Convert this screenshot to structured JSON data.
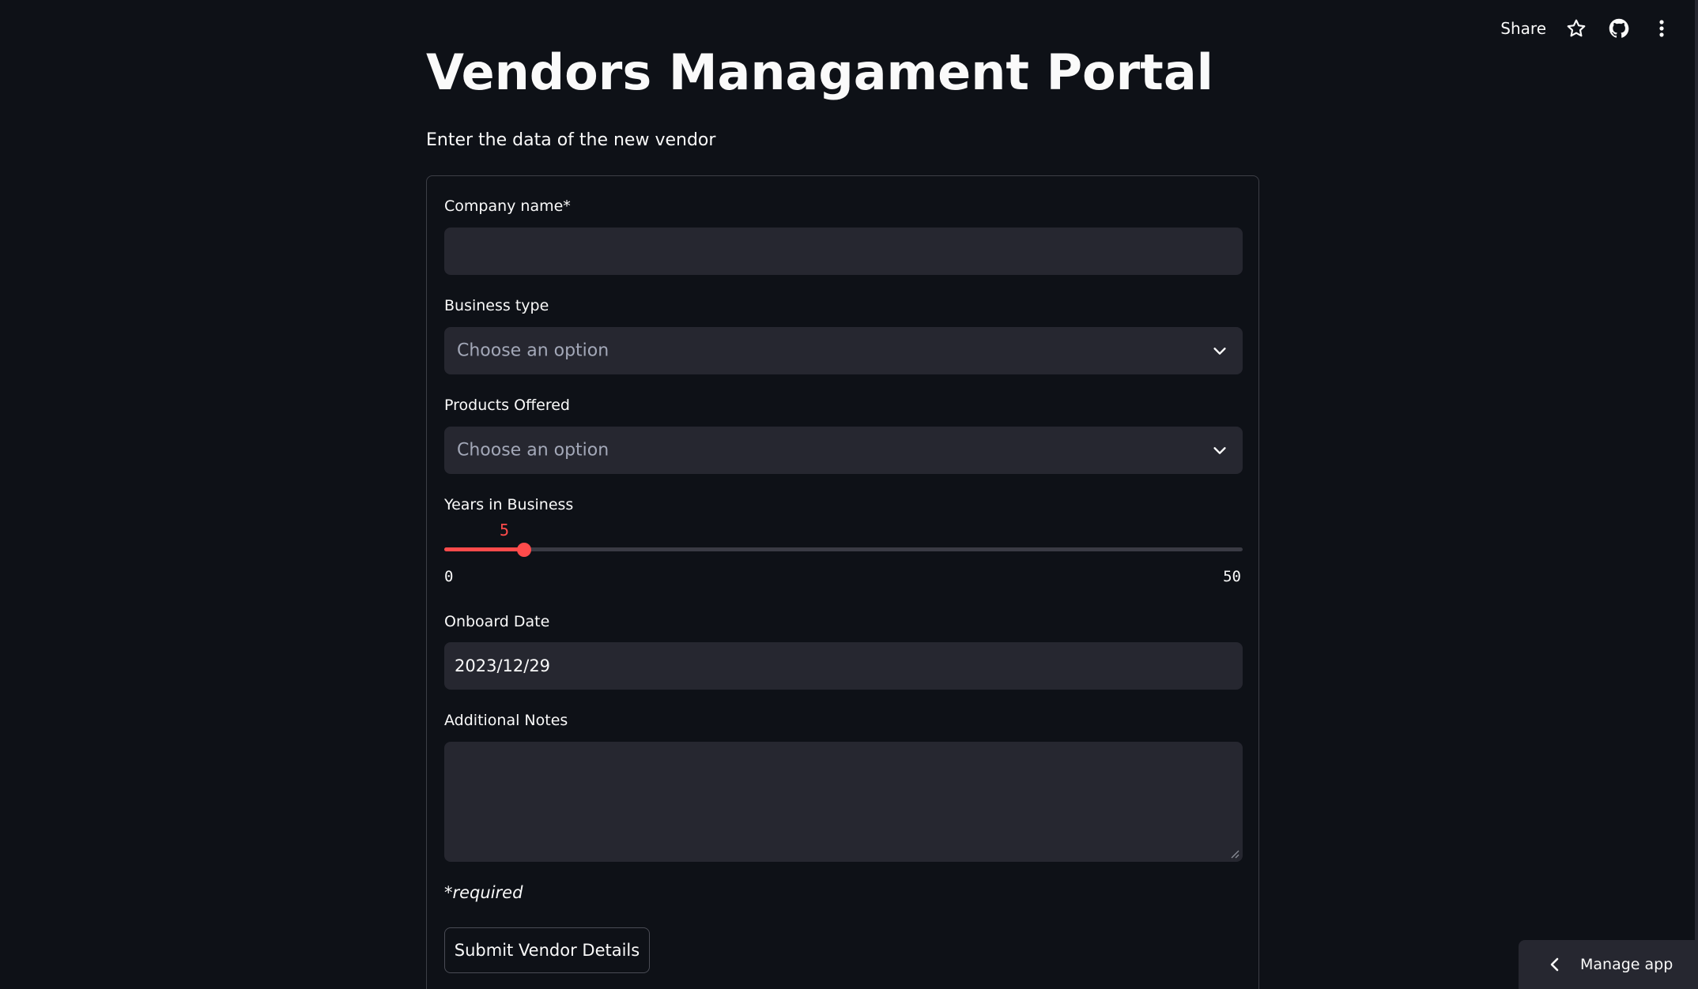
{
  "toolbar": {
    "share_label": "Share",
    "star_icon": "star-icon",
    "github_icon": "github-icon",
    "menu_icon": "kebab-menu-icon"
  },
  "page": {
    "title": "Vendors Managament Portal",
    "subtitle": "Enter the data of the new vendor"
  },
  "form": {
    "company_name": {
      "label": "Company name*",
      "value": ""
    },
    "business_type": {
      "label": "Business type",
      "placeholder": "Choose an option"
    },
    "products_offered": {
      "label": "Products Offered",
      "placeholder": "Choose an option"
    },
    "years_in_business": {
      "label": "Years in Business",
      "value": "5",
      "min": "0",
      "max": "50"
    },
    "onboard_date": {
      "label": "Onboard Date",
      "value": "2023/12/29"
    },
    "additional_notes": {
      "label": "Additional Notes",
      "value": ""
    },
    "required_note": "*required",
    "submit_label": "Submit Vendor Details"
  },
  "manage_app": {
    "label": "Manage app"
  },
  "colors": {
    "background": "#0e1117",
    "field_bg": "#262730",
    "accent": "#ff4b4b"
  }
}
